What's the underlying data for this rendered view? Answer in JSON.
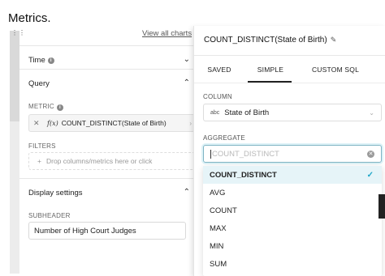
{
  "page": {
    "title": "Metrics."
  },
  "view_all_link": "View all charts",
  "left_panel": {
    "time_section": {
      "label": "Time",
      "chevron": "chevron-down-icon"
    },
    "query_section": {
      "label": "Query",
      "chevron": "chevron-up-icon"
    },
    "metric_label": "METRIC",
    "metric_value": "COUNT_DISTINCT(State of Birth)",
    "metric_fx": "f(x)",
    "filters_label": "FILTERS",
    "filters_placeholder": "Drop columns/metrics here or click",
    "display_section": {
      "label": "Display settings",
      "chevron": "chevron-up-icon"
    },
    "subheader_label": "SUBHEADER",
    "subheader_value": "Number of High Court Judges"
  },
  "popover": {
    "title": "COUNT_DISTINCT(State of Birth)",
    "tabs": [
      {
        "label": "SAVED",
        "active": false
      },
      {
        "label": "SIMPLE",
        "active": true
      },
      {
        "label": "CUSTOM SQL",
        "active": false
      }
    ],
    "column_label": "COLUMN",
    "column_type": "abc",
    "column_value": "State of Birth",
    "aggregate_label": "AGGREGATE",
    "aggregate_placeholder": "COUNT_DISTINCT",
    "aggregate_options": [
      {
        "label": "COUNT_DISTINCT",
        "selected": true
      },
      {
        "label": "AVG",
        "selected": false
      },
      {
        "label": "COUNT",
        "selected": false
      },
      {
        "label": "MAX",
        "selected": false
      },
      {
        "label": "MIN",
        "selected": false
      },
      {
        "label": "SUM",
        "selected": false
      }
    ]
  },
  "colors": {
    "accent": "#20a7c9",
    "selected_bg": "#e6f4f8"
  }
}
